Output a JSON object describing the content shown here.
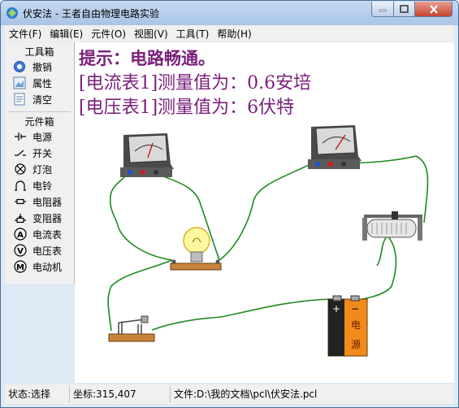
{
  "window": {
    "title": "伏安法 - 王者自由物理电路实验"
  },
  "menu": [
    {
      "label": "文件(F)"
    },
    {
      "label": "编辑(E)"
    },
    {
      "label": "元件(O)"
    },
    {
      "label": "视图(V)"
    },
    {
      "label": "工具(T)"
    },
    {
      "label": "帮助(H)"
    }
  ],
  "toolbox": {
    "title": "工具箱",
    "items": [
      {
        "label": "撤销",
        "icon": "undo-icon"
      },
      {
        "label": "属性",
        "icon": "properties-icon"
      },
      {
        "label": "清空",
        "icon": "clear-icon"
      }
    ]
  },
  "components": {
    "title": "元件箱",
    "items": [
      {
        "label": "电源",
        "icon": "battery-icon"
      },
      {
        "label": "开关",
        "icon": "switch-icon"
      },
      {
        "label": "灯泡",
        "icon": "lamp-icon"
      },
      {
        "label": "电铃",
        "icon": "bell-icon"
      },
      {
        "label": "电阻器",
        "icon": "resistor-icon"
      },
      {
        "label": "变阻器",
        "icon": "rheostat-icon"
      },
      {
        "label": "电流表",
        "icon": "ammeter-icon"
      },
      {
        "label": "电压表",
        "icon": "voltmeter-icon"
      },
      {
        "label": "电动机",
        "icon": "motor-icon"
      }
    ]
  },
  "canvas": {
    "hint": "提示：电路畅通。",
    "ammeter_reading": "[电流表1]测量值为：0.6安培",
    "voltmeter_reading": "[电压表1]测量值为：6伏特",
    "battery_label_top": "电",
    "battery_label_bottom": "源",
    "colors": {
      "text": "#7a1f7a",
      "wire": "#1f8a1f"
    }
  },
  "status": {
    "state": "状态:选择",
    "coords": "坐标:315,407",
    "file": "文件:D:\\我的文档\\pcl\\伏安法.pcl"
  }
}
